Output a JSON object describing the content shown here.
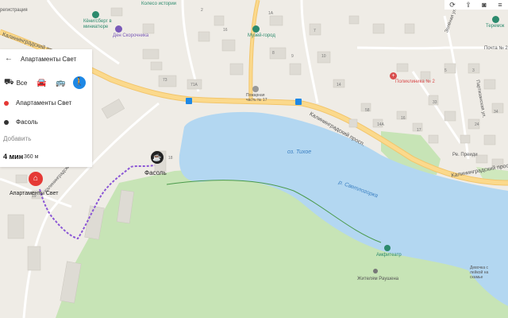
{
  "route_panel": {
    "back_icon": "arrow-left-icon",
    "title": "Апартаменты Свет",
    "modes": {
      "all_label": "Все",
      "car_icon": "car-icon",
      "bus_icon": "bus-icon",
      "walk_icon": "pedestrian-icon"
    },
    "point_a": {
      "label": "Апартаменты Свет",
      "color": "#e53935"
    },
    "point_b": {
      "label": "Фасоль",
      "color": "#333333"
    },
    "add_label": "Добавить",
    "summary": {
      "time": "4 мин",
      "distance": "360 м"
    }
  },
  "toolbar": {
    "icons": [
      "refresh-icon",
      "share-icon",
      "camera-icon",
      "menu-icon"
    ]
  },
  "colors": {
    "water": "#b3d7f1",
    "park": "#c7e4b6",
    "road_major": "#fbd98c",
    "road_minor": "#ffffff",
    "building": "#dedbd4",
    "route": "#8a55d6",
    "accent": "#1e88e5"
  },
  "map": {
    "street_kaliningradsky_1": "Калининградский прос",
    "street_kaliningradsky_2": "Калининградский просп.",
    "street_kaliningradsky_3": "Калининградский просп.",
    "street_kaliningradsky_4": "Калининградский пр.",
    "street_zelenaya": "Зелёная ул.",
    "street_partizanskaya": "Партизанская ул.",
    "lake_tikhoe": "оз. Тихое",
    "lake_svetlogorsk": "р. Светлогорка",
    "poi_fasol": "Фасоль",
    "poi_apartments": "Апартаменты Свет",
    "poi_koenigsberg": "Кёнигсберг в миниатюре",
    "poi_den_skorochnika": "Ден Скорочника",
    "poi_museum": "Музей-город",
    "poi_fire": "Пожарная часть № 17",
    "poi_polyclinic": "Поликлиника № 2",
    "poi_pochta": "Почта № 2",
    "poi_teremok": "Теремок",
    "poi_amphitheater": "Амфитеатр",
    "poi_zhitelyam": "Жителям Раушена",
    "poi_devochka": "Девочка с лейкой на скамье",
    "poi_koleso": "Колесо истории",
    "poi_registration": "регистрация",
    "street_resprenka": "Ре. Преиди",
    "house_numbers": [
      "73",
      "71А",
      "2",
      "16",
      "8",
      "9",
      "7",
      "10",
      "1А",
      "14",
      "5",
      "3",
      "34",
      "33",
      "24",
      "58",
      "14А",
      "16",
      "17",
      "18",
      "19"
    ]
  }
}
